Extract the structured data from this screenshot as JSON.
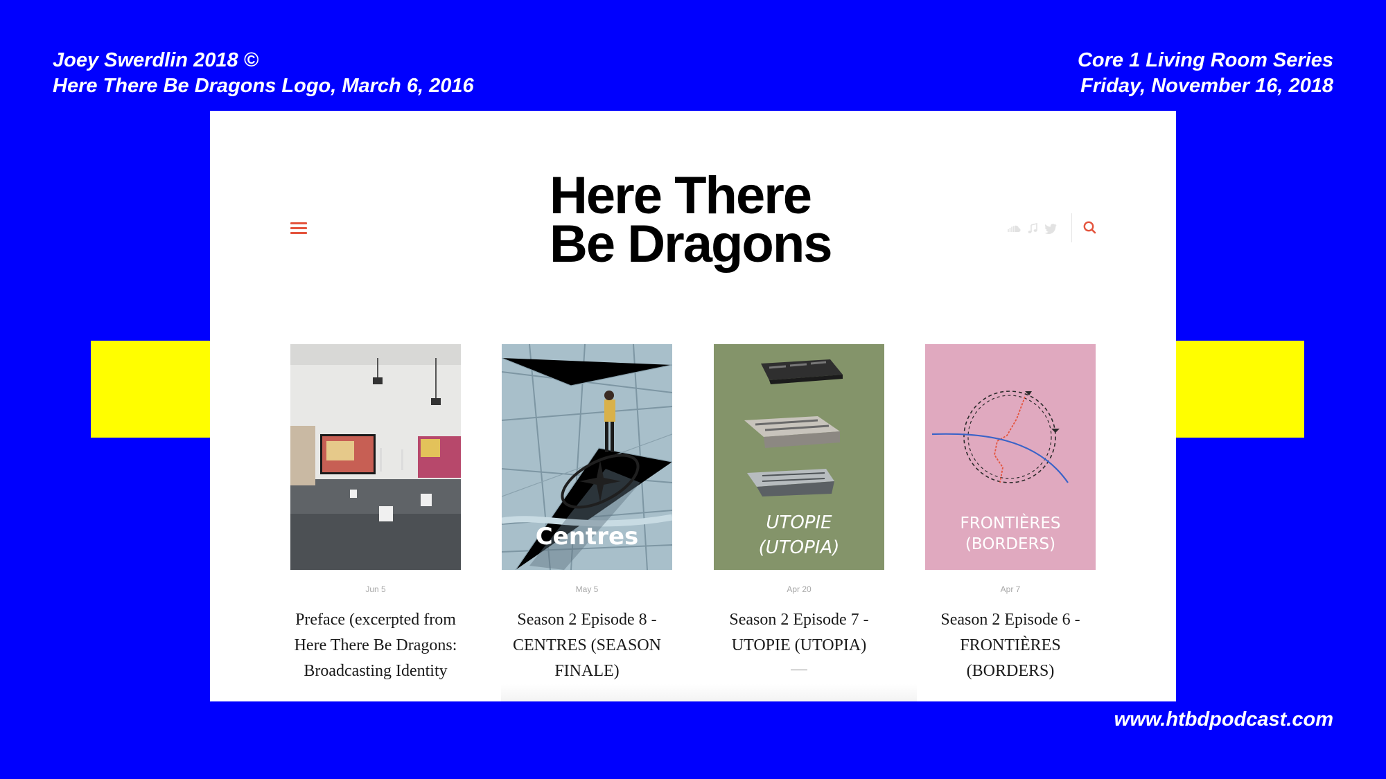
{
  "slide": {
    "top_left": [
      "Joey Swerdlin 2018 ©",
      "Here There Be Dragons Logo, March 6, 2016"
    ],
    "top_right": [
      "Core 1 Living Room Series",
      "Friday, November 16, 2018"
    ],
    "bottom_right": "www.htbdpodcast.com",
    "colors": {
      "background": "#0000fe",
      "band": "#fffe00",
      "accent": "#e4543d"
    }
  },
  "site": {
    "logo_lines": [
      "Here There",
      "Be Dragons"
    ],
    "menu_icon": "hamburger-menu-icon",
    "social_icons": [
      "soundcloud-icon",
      "music-note-icon",
      "twitter-icon"
    ],
    "search_icon": "search-icon"
  },
  "posts": [
    {
      "date": "Jun 5",
      "title": "Preface (excerpted from Here There Be Dragons: Broadcasting Identity",
      "thumb_label": "",
      "thumb_bg": "#6d6f73"
    },
    {
      "date": "May 5",
      "title": "Season 2 Episode 8 - CENTRES (SEASON FINALE)",
      "thumb_label": "Centres",
      "thumb_bg": "#a8bfca"
    },
    {
      "date": "Apr 20",
      "title": "Season 2 Episode 7 - UTOPIE (UTOPIA)",
      "thumb_label": "UTOPIE (UTOPIA)",
      "thumb_label_lines": [
        "UTOPIE",
        "(UTOPIA)"
      ],
      "thumb_bg": "#84946a"
    },
    {
      "date": "Apr 7",
      "title": "Season 2 Episode 6 - FRONTIÈRES (BORDERS)",
      "thumb_label": "FRONTIÈRES (BORDERS)",
      "thumb_label_lines": [
        "FRONTIÈRES",
        "(BORDERS)"
      ],
      "thumb_bg": "#e0a9bf"
    }
  ]
}
